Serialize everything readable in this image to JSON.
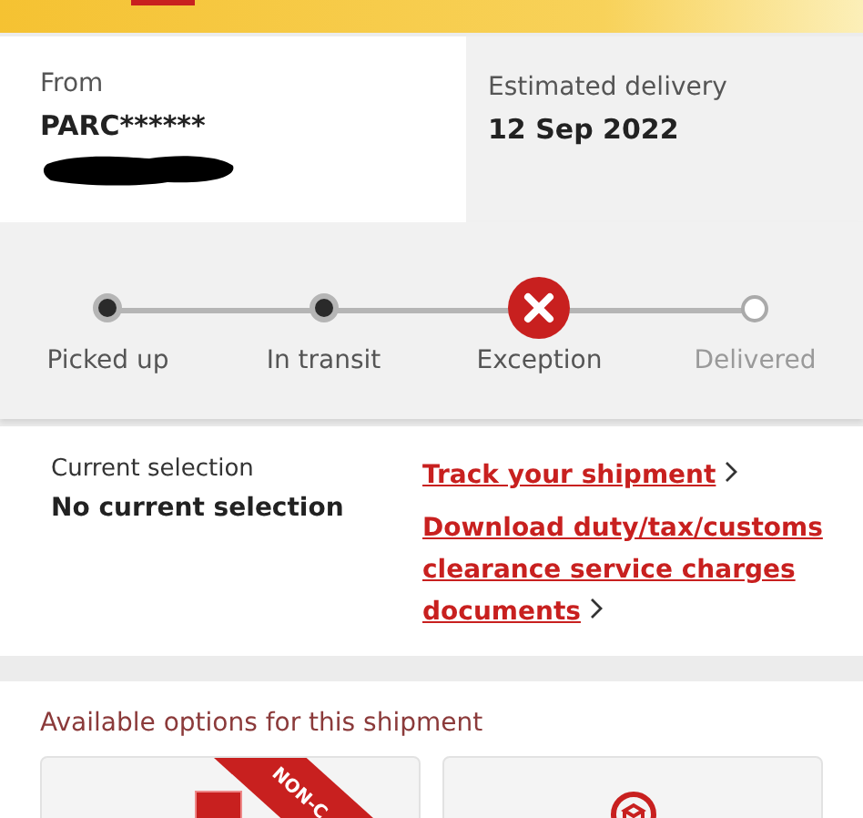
{
  "header": {
    "from_label": "From",
    "from_value": "PARC******",
    "estimate_label": "Estimated delivery",
    "estimate_value": "12 Sep 2022"
  },
  "steps": [
    {
      "label": "Picked up",
      "kind": "done"
    },
    {
      "label": "In transit",
      "kind": "done"
    },
    {
      "label": "Exception",
      "kind": "exception"
    },
    {
      "label": "Delivered",
      "kind": "pending"
    }
  ],
  "selection": {
    "label": "Current selection",
    "value": "No current selection"
  },
  "links": [
    "Track your shipment",
    "Download duty/tax/customs clearance service charges documents"
  ],
  "options": {
    "title": "Available options for this shipment",
    "ribbon": "NON-C"
  }
}
